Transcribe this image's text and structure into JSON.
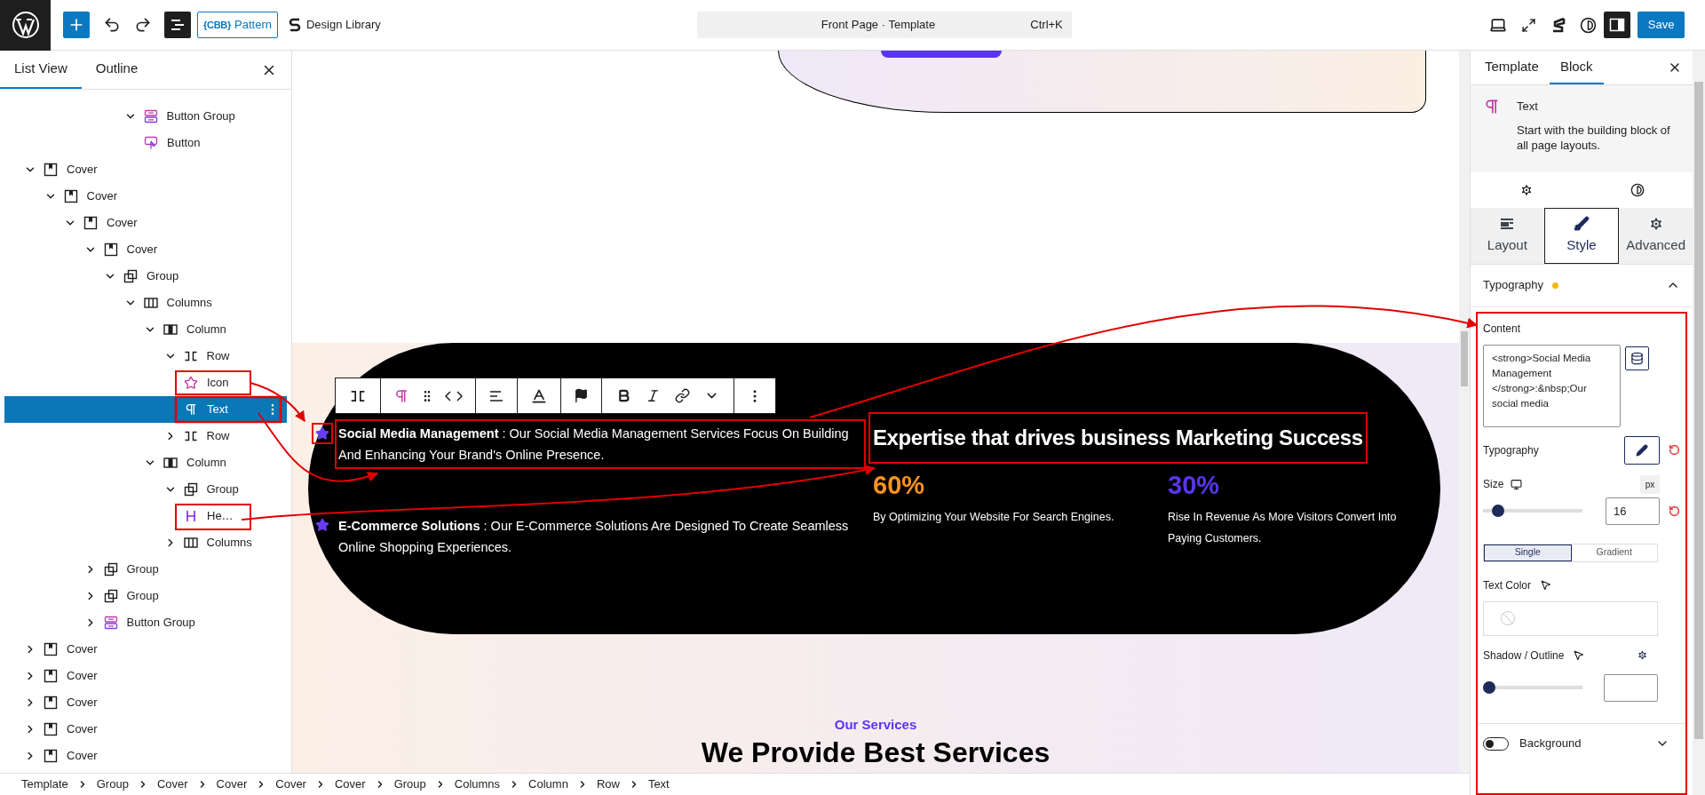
{
  "topbar": {
    "list_view_on": true,
    "pattern_logo": "{CBB}",
    "pattern_label": "Pattern",
    "design_library": "Design Library",
    "command": {
      "title": "Front Page · Template",
      "shortcut": "Ctrl+K"
    },
    "sidebar_on": true,
    "save": "Save"
  },
  "list_panel": {
    "tabs": [
      {
        "label": "List View",
        "selected": true
      },
      {
        "label": "Outline",
        "selected": false
      }
    ],
    "partial_branch": [
      {
        "label": "Button Group",
        "kind": "buttons",
        "selected": false,
        "expanded": true,
        "children": [
          {
            "label": "Button",
            "kind": "button",
            "selected": false
          }
        ]
      }
    ],
    "tree": [
      {
        "label": "Cover",
        "kind": "cover",
        "selected": false,
        "expanded": true,
        "children": [
          {
            "label": "Cover",
            "kind": "cover",
            "selected": false,
            "expanded": true,
            "children": [
              {
                "label": "Cover",
                "kind": "cover",
                "selected": false,
                "expanded": true,
                "children": [
                  {
                    "label": "Cover",
                    "kind": "cover",
                    "selected": false,
                    "expanded": true,
                    "children": [
                      {
                        "label": "Group",
                        "kind": "group",
                        "selected": false,
                        "expanded": true,
                        "children": [
                          {
                            "label": "Columns",
                            "kind": "columns",
                            "selected": false,
                            "expanded": true,
                            "children": [
                              {
                                "label": "Column",
                                "kind": "column",
                                "selected": false,
                                "expanded": true,
                                "children": [
                                  {
                                    "label": "Row",
                                    "kind": "row",
                                    "selected": false,
                                    "expanded": true,
                                    "children": [
                                      {
                                        "label": "Icon",
                                        "kind": "star",
                                        "selected": false
                                      },
                                      {
                                        "label": "Text",
                                        "kind": "text",
                                        "selected": true
                                      }
                                    ]
                                  },
                                  {
                                    "label": "Row",
                                    "kind": "row",
                                    "selected": false,
                                    "expanded": false
                                  }
                                ]
                              },
                              {
                                "label": "Column",
                                "kind": "column",
                                "selected": false,
                                "expanded": true,
                                "children": [
                                  {
                                    "label": "Group",
                                    "kind": "group",
                                    "selected": false,
                                    "expanded": true,
                                    "children": [
                                      {
                                        "label": "He…",
                                        "kind": "heading",
                                        "selected": false
                                      }
                                    ]
                                  },
                                  {
                                    "label": "Columns",
                                    "kind": "columns",
                                    "selected": false,
                                    "expanded": false
                                  }
                                ]
                              }
                            ]
                          }
                        ]
                      }
                    ]
                  },
                  {
                    "label": "Group",
                    "kind": "group",
                    "selected": false,
                    "expanded": false
                  },
                  {
                    "label": "Group",
                    "kind": "group",
                    "selected": false,
                    "expanded": false
                  },
                  {
                    "label": "Button Group",
                    "kind": "buttons",
                    "selected": false,
                    "expanded": false
                  }
                ]
              }
            ]
          }
        ]
      },
      {
        "label": "Cover",
        "kind": "cover",
        "selected": false,
        "expanded": false
      },
      {
        "label": "Cover",
        "kind": "cover",
        "selected": false,
        "expanded": false
      },
      {
        "label": "Cover",
        "kind": "cover",
        "selected": false,
        "expanded": false
      },
      {
        "label": "Cover",
        "kind": "cover",
        "selected": false,
        "expanded": false
      },
      {
        "label": "Cover",
        "kind": "cover",
        "selected": false,
        "expanded": false
      }
    ]
  },
  "canvas": {
    "services": [
      "**Social Media Management** : Our Social Media Management Services Focus On Building And Enhancing Your Brand's Online Presence.",
      "**E-Commerce Solutions** : Our E-Commerce Solutions Are Designed To Create Seamless Online Shopping Experiences."
    ],
    "headline": "Expertise that drives business Marketing Success",
    "stats": [
      {
        "value": "60%",
        "caption": "By Optimizing Your Website For Search Engines.",
        "color": "#f7931e"
      },
      {
        "value": "30%",
        "caption": "Rise In Revenue As More Visitors Convert Into Paying Customers.",
        "color": "#5a35f0"
      }
    ],
    "section_label": "Our Services",
    "section_title": "We Provide Best Services"
  },
  "inspector": {
    "tabs": [
      {
        "label": "Template",
        "selected": false
      },
      {
        "label": "Block",
        "selected": true
      }
    ],
    "block": {
      "name": "Text",
      "description": "Start with the building block of all page layouts."
    },
    "style_tabs": [
      {
        "label": "Layout",
        "kind": "layout",
        "selected": false
      },
      {
        "label": "Style",
        "kind": "brush",
        "selected": true
      },
      {
        "label": "Advanced",
        "kind": "gear",
        "selected": false
      }
    ],
    "typography": {
      "title": "Typography",
      "modified": true,
      "expanded": true,
      "content_label": "Content",
      "content": "<strong>Social Media Management </strong>:&nbsp;Our social media",
      "typography_label": "Typography",
      "size_label": "Size",
      "unit": "px",
      "size_slider": {
        "level": 0.1
      },
      "size_value": "16",
      "color_modes": [
        {
          "label": "Single",
          "selected": true
        },
        {
          "label": "Gradient",
          "selected": false
        }
      ],
      "text_color_label": "Text Color",
      "shadow_label": "Shadow / Outline",
      "shadow_slider": {
        "level": 0
      }
    },
    "background": {
      "label": "Background",
      "on": false
    }
  },
  "breadcrumb": [
    "Template",
    "Group",
    "Cover",
    "Cover",
    "Cover",
    "Cover",
    "Group",
    "Columns",
    "Column",
    "Row",
    "Text"
  ]
}
